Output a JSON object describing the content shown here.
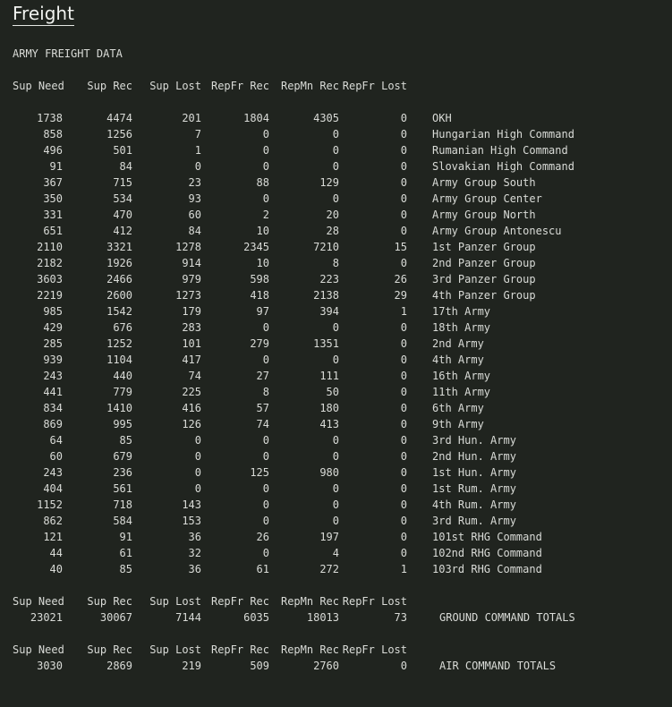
{
  "page": {
    "title": "Freight",
    "section_heading": "ARMY FREIGHT DATA"
  },
  "colors": {
    "background": "#20241f",
    "text": "#d9dbd7",
    "title": "#f0f2ef"
  },
  "table": {
    "columns": [
      "Sup Need",
      "Sup Rec",
      "Sup Lost",
      "RepFr Rec",
      "RepMn Rec",
      "RepFr Lost"
    ],
    "rows": [
      {
        "values": [
          "1738",
          "4474",
          "201",
          "1804",
          "4305",
          "0"
        ],
        "name": "OKH"
      },
      {
        "values": [
          "858",
          "1256",
          "7",
          "0",
          "0",
          "0"
        ],
        "name": "Hungarian High Command"
      },
      {
        "values": [
          "496",
          "501",
          "1",
          "0",
          "0",
          "0"
        ],
        "name": "Rumanian High Command"
      },
      {
        "values": [
          "91",
          "84",
          "0",
          "0",
          "0",
          "0"
        ],
        "name": "Slovakian High Command"
      },
      {
        "values": [
          "367",
          "715",
          "23",
          "88",
          "129",
          "0"
        ],
        "name": "Army Group South"
      },
      {
        "values": [
          "350",
          "534",
          "93",
          "0",
          "0",
          "0"
        ],
        "name": "Army Group Center"
      },
      {
        "values": [
          "331",
          "470",
          "60",
          "2",
          "20",
          "0"
        ],
        "name": "Army Group North"
      },
      {
        "values": [
          "651",
          "412",
          "84",
          "10",
          "28",
          "0"
        ],
        "name": "Army Group Antonescu"
      },
      {
        "values": [
          "2110",
          "3321",
          "1278",
          "2345",
          "7210",
          "15"
        ],
        "name": "1st Panzer Group"
      },
      {
        "values": [
          "2182",
          "1926",
          "914",
          "10",
          "8",
          "0"
        ],
        "name": "2nd Panzer Group"
      },
      {
        "values": [
          "3603",
          "2466",
          "979",
          "598",
          "223",
          "26"
        ],
        "name": "3rd Panzer Group"
      },
      {
        "values": [
          "2219",
          "2600",
          "1273",
          "418",
          "2138",
          "29"
        ],
        "name": "4th Panzer Group"
      },
      {
        "values": [
          "985",
          "1542",
          "179",
          "97",
          "394",
          "1"
        ],
        "name": "17th Army"
      },
      {
        "values": [
          "429",
          "676",
          "283",
          "0",
          "0",
          "0"
        ],
        "name": "18th Army"
      },
      {
        "values": [
          "285",
          "1252",
          "101",
          "279",
          "1351",
          "0"
        ],
        "name": "2nd Army"
      },
      {
        "values": [
          "939",
          "1104",
          "417",
          "0",
          "0",
          "0"
        ],
        "name": "4th Army"
      },
      {
        "values": [
          "243",
          "440",
          "74",
          "27",
          "111",
          "0"
        ],
        "name": "16th Army"
      },
      {
        "values": [
          "441",
          "779",
          "225",
          "8",
          "50",
          "0"
        ],
        "name": "11th Army"
      },
      {
        "values": [
          "834",
          "1410",
          "416",
          "57",
          "180",
          "0"
        ],
        "name": "6th Army"
      },
      {
        "values": [
          "869",
          "995",
          "126",
          "74",
          "413",
          "0"
        ],
        "name": "9th Army"
      },
      {
        "values": [
          "64",
          "85",
          "0",
          "0",
          "0",
          "0"
        ],
        "name": "3rd Hun. Army"
      },
      {
        "values": [
          "60",
          "679",
          "0",
          "0",
          "0",
          "0"
        ],
        "name": "2nd Hun. Army"
      },
      {
        "values": [
          "243",
          "236",
          "0",
          "125",
          "980",
          "0"
        ],
        "name": "1st Hun. Army"
      },
      {
        "values": [
          "404",
          "561",
          "0",
          "0",
          "0",
          "0"
        ],
        "name": "1st Rum. Army"
      },
      {
        "values": [
          "1152",
          "718",
          "143",
          "0",
          "0",
          "0"
        ],
        "name": "4th Rum. Army"
      },
      {
        "values": [
          "862",
          "584",
          "153",
          "0",
          "0",
          "0"
        ],
        "name": "3rd Rum. Army"
      },
      {
        "values": [
          "121",
          "91",
          "36",
          "26",
          "197",
          "0"
        ],
        "name": "101st RHG Command"
      },
      {
        "values": [
          "44",
          "61",
          "32",
          "0",
          "4",
          "0"
        ],
        "name": "102nd RHG Command"
      },
      {
        "values": [
          "40",
          "85",
          "36",
          "61",
          "272",
          "1"
        ],
        "name": "103rd RHG Command"
      }
    ],
    "totals": [
      {
        "values": [
          "23021",
          "30067",
          "7144",
          "6035",
          "18013",
          "73"
        ],
        "name": "GROUND COMMAND TOTALS"
      },
      {
        "values": [
          "3030",
          "2869",
          "219",
          "509",
          "2760",
          "0"
        ],
        "name": "AIR COMMAND TOTALS"
      }
    ]
  }
}
